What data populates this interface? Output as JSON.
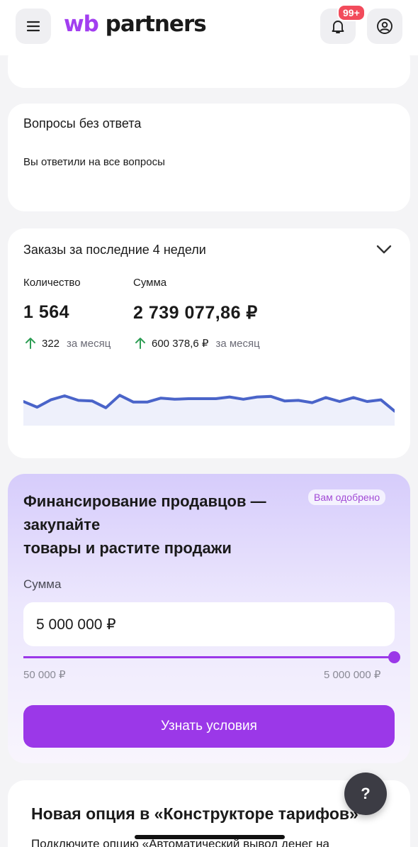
{
  "header": {
    "logo_wb": "wb",
    "logo_partners": "partners",
    "notification_count": "99+"
  },
  "questions_card": {
    "title": "Вопросы без ответа",
    "subtitle": "Вы ответили на все вопросы"
  },
  "orders_card": {
    "title": "Заказы за последние 4 недели",
    "quantity_label": "Количество",
    "quantity_value": "1 564",
    "quantity_delta": "322",
    "quantity_delta_period": "за месяц",
    "sum_label": "Сумма",
    "sum_value": "2 739 077,86 ₽",
    "sum_delta": "600 378,6 ₽",
    "sum_delta_period": "за месяц",
    "sparkline": [
      55,
      65,
      52,
      45,
      53,
      54,
      66,
      44,
      56,
      56,
      49,
      51,
      50,
      50,
      50,
      47,
      51,
      47,
      46,
      54,
      53,
      57,
      48,
      55,
      48,
      55,
      52,
      72
    ],
    "line_color": "#4a64c9"
  },
  "finance_card": {
    "title_line1": "Финансирование продавцов —",
    "title_line2": "закупайте",
    "title_line3": "товары и растите продажи",
    "badge": "Вам одобрено",
    "sum_label": "Сумма",
    "sum_value": "5 000 000 ₽",
    "slider_min": "50 000 ₽",
    "slider_max": "5 000 000 ₽",
    "slider_fraction": 1.0,
    "button_label": "Узнать условия",
    "accent_color": "#9b38e8"
  },
  "news_card": {
    "title": "Новая опция в «Конструкторе тарифов»",
    "text": "Подключите опцию «Автоматический вывод денег на"
  },
  "help_button": {
    "label": "?"
  }
}
